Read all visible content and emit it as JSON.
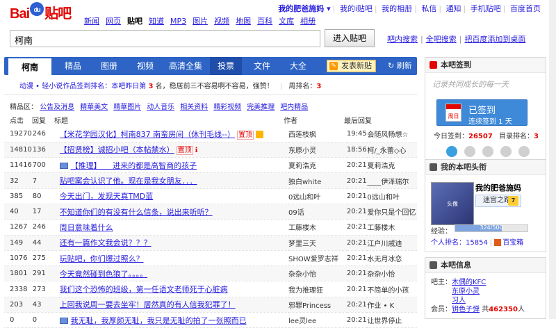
{
  "logo": {
    "text": "Bai",
    "du": "du",
    "cn": "贴吧"
  },
  "products": [
    "新闻",
    "网页",
    "贴吧",
    "知道",
    "MP3",
    "图片",
    "视频",
    "地图",
    "百科",
    "文库",
    "相册"
  ],
  "user_links": {
    "user": "我的肥爸施妈 ▾",
    "links": [
      "我的i贴吧",
      "我的相册",
      "私信",
      "通知",
      "手机贴吧",
      "百度首页"
    ]
  },
  "search": {
    "value": "柯南",
    "button": "进入贴吧",
    "links": [
      "吧内搜索",
      "全吧搜索",
      "把百度添加到桌面"
    ]
  },
  "nav": {
    "tabs": [
      "柯南",
      "精品",
      "图册",
      "视频",
      "高清全集",
      "投票",
      "文件",
      "大全"
    ],
    "post_button": "发表新贴",
    "refresh": "刷新"
  },
  "notice": {
    "prefix": "动漫 • 轻小说作品签到排名：本吧昨日第",
    "rank": "3",
    "mid": "名，稳居前三不容易啊不容易，强赞！",
    "week_label": "周排名：",
    "week_rank": "3"
  },
  "good_area": {
    "label": "精品区：",
    "items": [
      "公告及消息",
      "精華美文",
      "精華图片",
      "动人音乐",
      "相关资料",
      "精彩视频",
      "完美推理",
      "吧内精品"
    ]
  },
  "table_header": {
    "click": "点击",
    "reply": "回复",
    "title": "标题",
    "author": "作者",
    "last": "最后回复"
  },
  "threads": [
    {
      "click": "19270",
      "reply": "246",
      "title": "【米花学园汉化】柯南837 南蛮房间（休刊毛线--）",
      "tag": "置顶",
      "icon": "good",
      "author": "西莲枝枫",
      "time": "19:45",
      "last": "会随风畅想☆"
    },
    {
      "click": "14810",
      "reply": "136",
      "title": "【招贤榜】诚招小吧（本帖禁水）",
      "tag": "置顶",
      "icon": "v",
      "author": "东原小灵",
      "time": "18:56",
      "last": "柯/_永蕾◇心"
    },
    {
      "click": "11416",
      "reply": "700",
      "title": "【推理】　　进来的都是高智商的孩子",
      "tag": "",
      "icon": "img",
      "author": "夏莉浩克",
      "time": "20:21",
      "last": "夏莉浩克"
    },
    {
      "click": "32",
      "reply": "7",
      "title": "贴吧案会认识了他。现在是我女朋友．．．",
      "tag": "",
      "icon": "",
      "author": "独白white",
      "time": "20:21",
      "last": "____伊泽瑞尔"
    },
    {
      "click": "385",
      "reply": "80",
      "title": "今天出门，发现天真TMD蓝",
      "tag": "",
      "icon": "",
      "author": "0远山和叶",
      "time": "20:21",
      "last": "0远山和叶"
    },
    {
      "click": "40",
      "reply": "17",
      "title": "不知道你们的有没有什么信条，说出来听听？",
      "tag": "",
      "icon": "",
      "author": "09话",
      "time": "20:21",
      "last": "爱你只是个回忆"
    },
    {
      "click": "1267",
      "reply": "246",
      "title": "周日意味着什么",
      "tag": "",
      "icon": "",
      "author": "工藤楼木",
      "time": "20:21",
      "last": "工藤楼木"
    },
    {
      "click": "149",
      "reply": "44",
      "title": "还有一篇作文我会说？？？",
      "tag": "",
      "icon": "",
      "author": "梦里三天",
      "time": "20:21",
      "last": "江户川戚迪"
    },
    {
      "click": "1076",
      "reply": "275",
      "title": "玩贴吧，你们爆过照么？",
      "tag": "",
      "icon": "",
      "author": "SHOW爱罗志祥",
      "time": "20:21",
      "last": "水无月冰恋"
    },
    {
      "click": "1801",
      "reply": "291",
      "title": "今天竟然碰到色狼了。。。。",
      "tag": "",
      "icon": "",
      "author": "杂杂小怡",
      "time": "20:21",
      "last": "杂杂小怡"
    },
    {
      "click": "2338",
      "reply": "273",
      "title": "我们这个恐怖的班级，第一任语文老师死于心脏病",
      "tag": "",
      "icon": "",
      "author": "我为推理狂",
      "time": "20:21",
      "last": "不简单的小孩"
    },
    {
      "click": "203",
      "reply": "43",
      "title": "上回我说周一要去坐牢！居然真的有人信我犯罪了！",
      "tag": "",
      "icon": "",
      "author": "邪罪Princess",
      "time": "20:21",
      "last": "作业 • K"
    },
    {
      "click": "0",
      "reply": "0",
      "title": "我无耻，我厚颜无耻，我只是无耻的拍了一张照而已",
      "tag": "",
      "icon": "img",
      "author": "lee灵lee",
      "time": "20:21",
      "last": "让世界停止"
    }
  ],
  "sign": {
    "title": "本吧签到",
    "handwriting": "记录共同成长的每一天",
    "status": "已签到",
    "continuous": "连续签到 1 天",
    "calendar": "周日",
    "today_label": "今日签到：",
    "today_count": "26507",
    "rank_label": "目录排名：",
    "rank": "3"
  },
  "my_head": {
    "title": "我的本吧头衔",
    "avatar": "头像",
    "name": "我的肥爸施妈",
    "level_name": "迷宫之路",
    "level": "7",
    "exp_label": "经验：",
    "exp": "324/500",
    "exp_value": 324,
    "exp_max": 500,
    "personal_rank": "个人排名：15854",
    "box": "百宝箱"
  },
  "bar_info": {
    "title": "本吧信息",
    "owner_label": "吧主：",
    "owners": [
      "木偶的KFC",
      "东原小灵",
      "习人"
    ],
    "member_label": "会员：",
    "member_name": "钥色子弹",
    "member_count_prefix": "共",
    "member_count": "462350",
    "member_count_suffix": "人"
  },
  "colors": {
    "nav": "#2d64c6",
    "link": "#261cdc",
    "red": "#e10602"
  }
}
